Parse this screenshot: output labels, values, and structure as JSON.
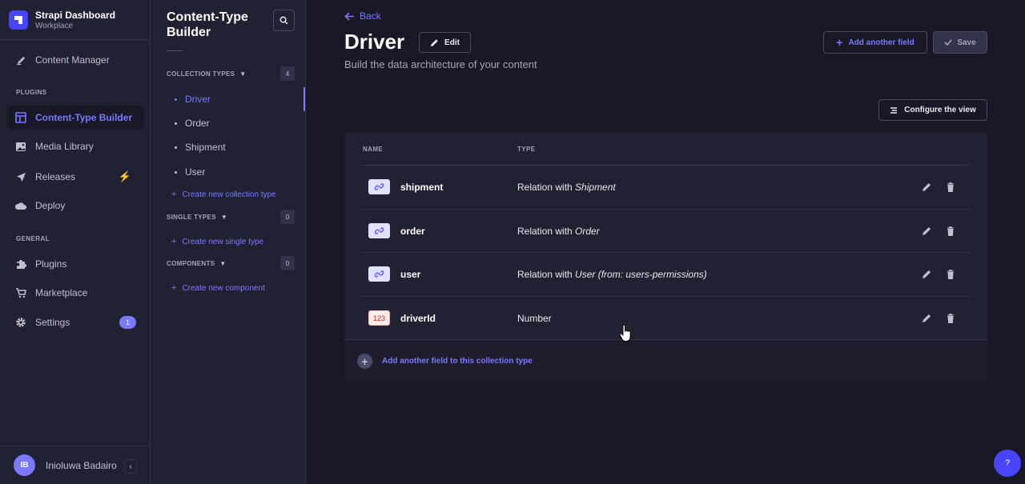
{
  "brand": {
    "title": "Strapi Dashboard",
    "subtitle": "Workplace"
  },
  "mainnav": {
    "content_manager": "Content Manager",
    "plugins_section": "PLUGINS",
    "ctb": "Content-Type Builder",
    "media_library": "Media Library",
    "releases": "Releases",
    "deploy": "Deploy",
    "general_section": "GENERAL",
    "plugins": "Plugins",
    "marketplace": "Marketplace",
    "settings": "Settings",
    "settings_badge": "1"
  },
  "user": {
    "initials": "IB",
    "name": "Inioluwa Badairo"
  },
  "subnav": {
    "title": "Content-Type Builder",
    "collection_types": {
      "label": "COLLECTION TYPES",
      "count": "4",
      "items": [
        "Driver",
        "Order",
        "Shipment",
        "User"
      ],
      "create": "Create new collection type"
    },
    "single_types": {
      "label": "SINGLE TYPES",
      "count": "0",
      "create": "Create new single type"
    },
    "components": {
      "label": "COMPONENTS",
      "count": "0",
      "create": "Create new component"
    }
  },
  "header": {
    "back": "Back",
    "title": "Driver",
    "edit": "Edit",
    "subtitle": "Build the data architecture of your content",
    "add_field": "Add another field",
    "save": "Save",
    "configure": "Configure the view"
  },
  "table": {
    "col_name": "NAME",
    "col_type": "TYPE",
    "rows": [
      {
        "icon": "relation-icon",
        "name": "shipment",
        "type_prefix": "Relation with ",
        "type_target": "Shipment"
      },
      {
        "icon": "relation-icon",
        "name": "order",
        "type_prefix": "Relation with ",
        "type_target": "Order"
      },
      {
        "icon": "relation-icon",
        "name": "user",
        "type_prefix": "Relation with ",
        "type_target": "User (from: users-permissions)"
      },
      {
        "icon": "number-icon",
        "icon_text": "123",
        "name": "driverId",
        "type_prefix": "Number",
        "type_target": ""
      }
    ],
    "footer_add": "Add another field to this collection type"
  },
  "help": "?",
  "colors": {
    "accent": "#7b79ff",
    "primary": "#4945ff",
    "background": "#181826",
    "panel": "#212134"
  }
}
